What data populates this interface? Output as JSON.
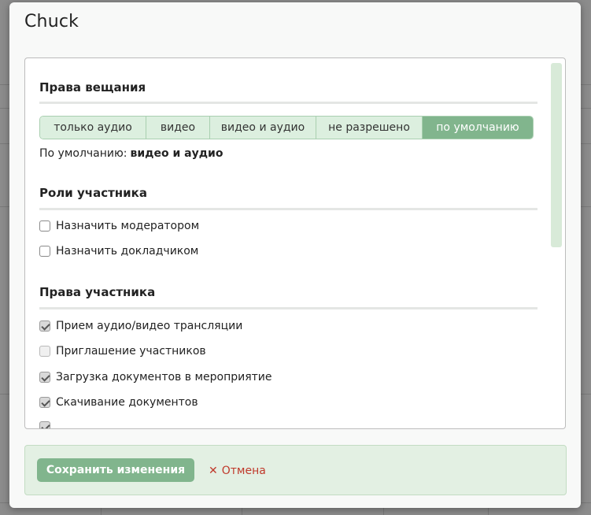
{
  "modal": {
    "title": "Chuck",
    "broadcast": {
      "title": "Права вещания",
      "options": [
        "только аудио",
        "видео",
        "видео и аудио",
        "не разрешено",
        "по умолчанию"
      ],
      "active_index": 4,
      "default_label": "По умолчанию:",
      "default_value": "видео и аудио"
    },
    "roles": {
      "title": "Роли участника",
      "items": [
        {
          "label": "Назначить модератором",
          "checked": false
        },
        {
          "label": "Назначить докладчиком",
          "checked": false
        }
      ]
    },
    "rights": {
      "title": "Права участника",
      "items": [
        {
          "label": "Прием аудио/видео трансляции",
          "checked": true
        },
        {
          "label": "Приглашение участников",
          "checked": false,
          "disabled": true
        },
        {
          "label": "Загрузка документов в мероприятие",
          "checked": true
        },
        {
          "label": "Скачивание документов",
          "checked": true
        }
      ]
    },
    "footer": {
      "save_label": "Сохранить изменения",
      "cancel_label": "Отмена",
      "cancel_icon": "close-icon"
    }
  },
  "colors": {
    "accent": "#81b58d",
    "segment_bg": "#dcefdf",
    "cancel": "#c0392b"
  }
}
